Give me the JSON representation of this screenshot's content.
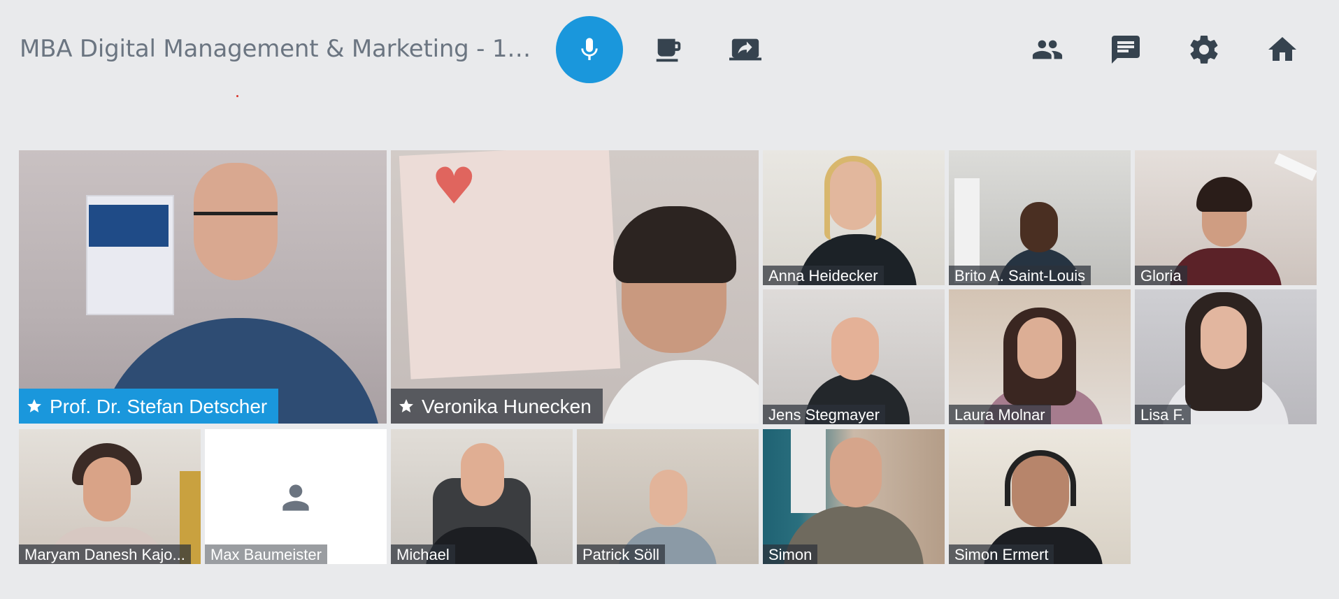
{
  "header": {
    "title": "MBA Digital Management & Marketing - 1. S...",
    "buttons": [
      {
        "name": "microphone-icon",
        "active": true
      },
      {
        "name": "coffee-icon"
      },
      {
        "name": "screen-share-icon"
      },
      {
        "name": "participants-icon"
      },
      {
        "name": "chat-icon"
      },
      {
        "name": "settings-icon"
      },
      {
        "name": "home-icon"
      }
    ]
  },
  "accent_color": "#1a97dc",
  "participants": [
    {
      "name": "Prof. Dr. Stefan Detscher",
      "starred": true,
      "active": true
    },
    {
      "name": "Veronika Hunecken",
      "starred": true
    },
    {
      "name": "Anna Heidecker"
    },
    {
      "name": "Brito A. Saint-Louis"
    },
    {
      "name": "Gloria"
    },
    {
      "name": "Jens Stegmayer"
    },
    {
      "name": "Laura Molnar"
    },
    {
      "name": "Lisa F."
    },
    {
      "name": "Maryam Danesh Kajo..."
    },
    {
      "name": "Max Baumeister",
      "video": false
    },
    {
      "name": "Michael"
    },
    {
      "name": "Patrick Söll"
    },
    {
      "name": "Simon"
    },
    {
      "name": "Simon Ermert"
    }
  ]
}
